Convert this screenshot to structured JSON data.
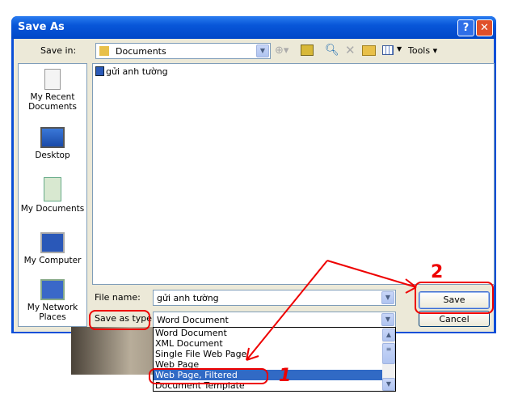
{
  "window": {
    "title": "Save As",
    "help_label": "?",
    "close_label": "✕"
  },
  "toolbar": {
    "save_in_label": "Save in:",
    "save_in_value": "Documents",
    "tools_label": "Tools ▾",
    "icons": [
      "back-icon",
      "up-folder-icon",
      "search-web-icon",
      "delete-icon",
      "new-folder-icon",
      "views-icon"
    ]
  },
  "places": [
    {
      "label": "My Recent Documents"
    },
    {
      "label": "Desktop"
    },
    {
      "label": "My Documents"
    },
    {
      "label": "My Computer"
    },
    {
      "label": "My Network Places"
    }
  ],
  "files": [
    {
      "name": "gửi anh tường",
      "icon": "word-doc-icon"
    }
  ],
  "form": {
    "file_name_label": "File name:",
    "file_name_value": "gửi anh tường",
    "type_label": "Save as type:",
    "type_value": "Word Document",
    "save_label": "Save",
    "cancel_label": "Cancel"
  },
  "type_options": [
    "Word Document",
    "XML Document",
    "Single File Web Page",
    "Web Page",
    "Web Page, Filtered",
    "Document Template"
  ],
  "selected_option": "Web Page, Filtered",
  "annotations": {
    "step1": "1",
    "step2": "2",
    "color": "#e00000"
  }
}
